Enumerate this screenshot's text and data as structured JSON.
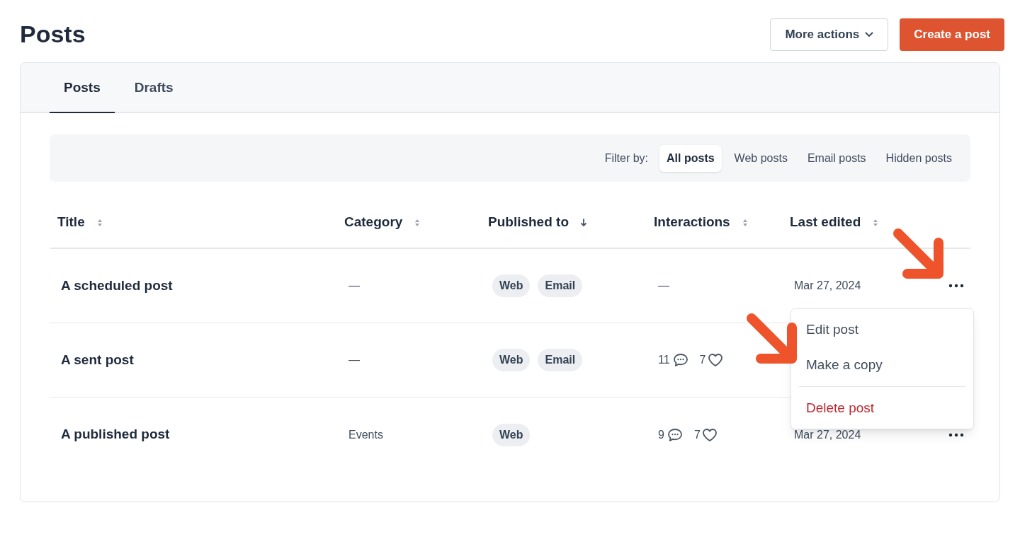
{
  "page": {
    "title": "Posts"
  },
  "header_buttons": [
    {
      "label": "More actions",
      "kind": "secondary"
    },
    {
      "label": "Create a post",
      "kind": "primary"
    }
  ],
  "tabs": [
    {
      "label": "Posts",
      "selected": true
    },
    {
      "label": "Drafts",
      "selected": false
    }
  ],
  "filter": {
    "label": "Filter by:",
    "options": [
      {
        "label": "All posts",
        "selected": true
      },
      {
        "label": "Web posts",
        "selected": false
      },
      {
        "label": "Email posts",
        "selected": false
      },
      {
        "label": "Hidden posts",
        "selected": false
      }
    ]
  },
  "table": {
    "columns": [
      {
        "label": "Title",
        "sorted": false
      },
      {
        "label": "Category",
        "sorted": false
      },
      {
        "label": "Published to",
        "sorted": true
      },
      {
        "label": "Interactions",
        "sorted": false
      },
      {
        "label": "Last edited",
        "sorted": false
      }
    ],
    "rows": [
      {
        "title": "A scheduled post",
        "category": "—",
        "channels": [
          "Web",
          "Email"
        ],
        "interactions": {
          "kind": "none",
          "text": "—"
        },
        "last_edited": "Mar 27, 2024",
        "menu_button": true
      },
      {
        "title": "A sent post",
        "category": "—",
        "channels": [
          "Web",
          "Email"
        ],
        "interactions": {
          "kind": "counts",
          "comments": "11",
          "likes": "7"
        },
        "menu_button": false
      },
      {
        "title": "A published post",
        "category": "Events",
        "channels": [
          "Web"
        ],
        "interactions": {
          "kind": "counts",
          "comments": "9",
          "likes": "7"
        },
        "last_edited": "Mar 27, 2024",
        "menu_button": true
      }
    ]
  },
  "context_menu": {
    "items": [
      {
        "label": "Edit post",
        "kind": "normal"
      },
      {
        "label": "Make a copy",
        "kind": "normal"
      },
      {
        "label": "Delete post",
        "kind": "danger"
      }
    ]
  }
}
